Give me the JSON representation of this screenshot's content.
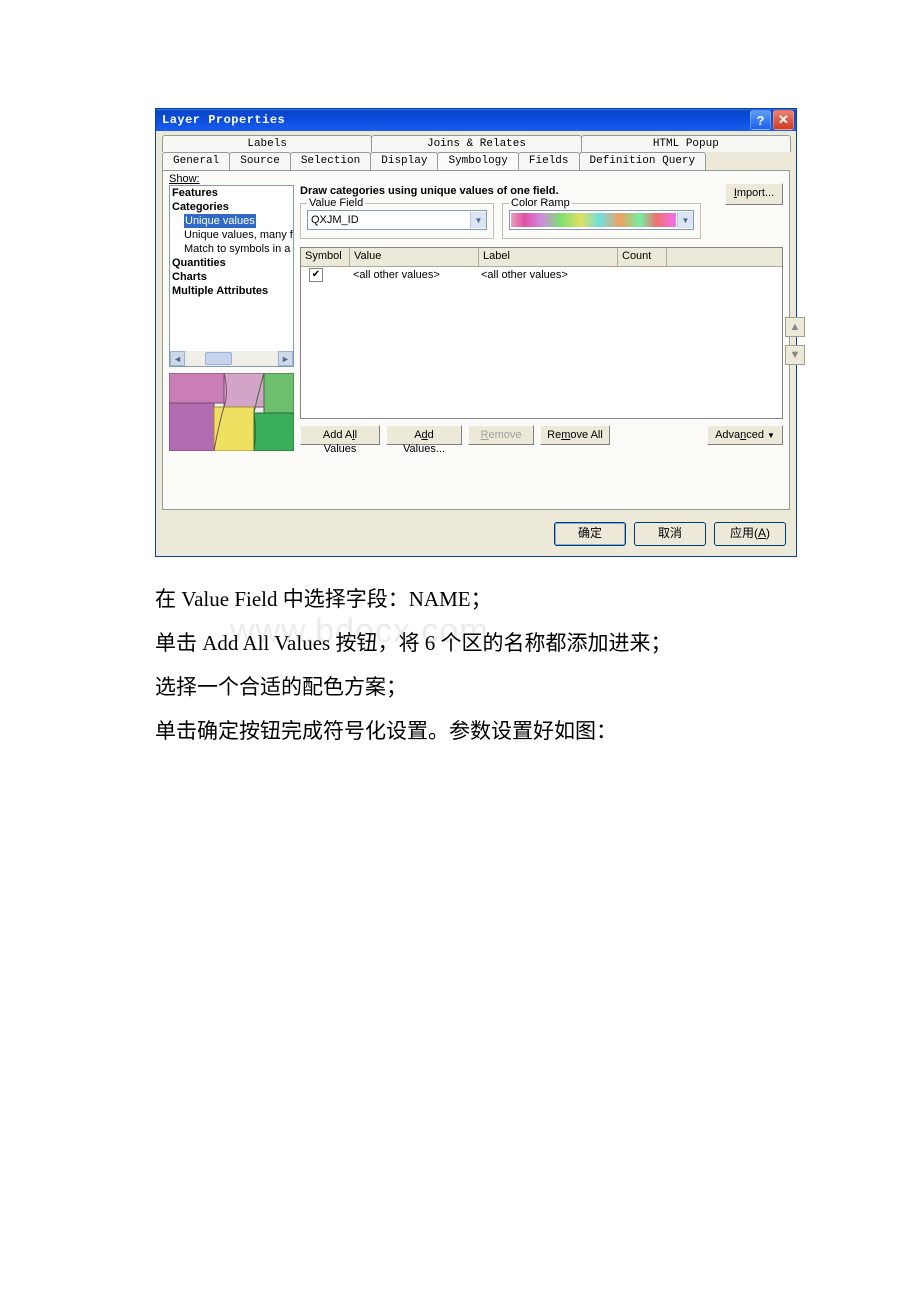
{
  "titlebar": {
    "title": "Layer Properties",
    "help_glyph": "?",
    "close_glyph": "✕"
  },
  "tabs": {
    "row1": [
      "Labels",
      "Joins & Relates",
      "HTML Popup"
    ],
    "row2": [
      "General",
      "Source",
      "Selection",
      "Display",
      "Symbology",
      "Fields",
      "Definition Query"
    ],
    "active": "Symbology"
  },
  "left_panel": {
    "show_label": "Show:",
    "items": {
      "features": "Features",
      "categories": "Categories",
      "unique_values": "Unique values",
      "unique_values_many": "Unique values, many f",
      "match_symbols": "Match to symbols in a",
      "quantities": "Quantities",
      "charts": "Charts",
      "multiple_attrs": "Multiple Attributes"
    }
  },
  "right_panel": {
    "description": "Draw categories using unique values of one field.",
    "import_label": "Import...",
    "value_field_legend": "Value Field",
    "value_field_value": "QXJM_ID",
    "color_ramp_legend": "Color Ramp",
    "table_headers": {
      "symbol": "Symbol",
      "value": "Value",
      "label": "Label",
      "count": "Count"
    },
    "rows": [
      {
        "checked": true,
        "value": "<all other values>",
        "label": "<all other values>",
        "count": ""
      }
    ],
    "buttons": {
      "add_all": "Add All Values",
      "add_values": "Add Values...",
      "remove": "Remove",
      "remove_all": "Remove All",
      "advanced": "Advanced"
    }
  },
  "dialog_buttons": {
    "ok": "确定",
    "cancel": "取消",
    "apply": "应用(A)"
  },
  "instructions": {
    "line1": "在 Value Field 中选择字段：NAME；",
    "line2": "单击 Add All Values 按钮，将 6 个区的名称都添加进来；",
    "line3": "选择一个合适的配色方案；",
    "line4": "单击确定按钮完成符号化设置。参数设置好如图："
  },
  "watermark": "www.bdocx.com"
}
